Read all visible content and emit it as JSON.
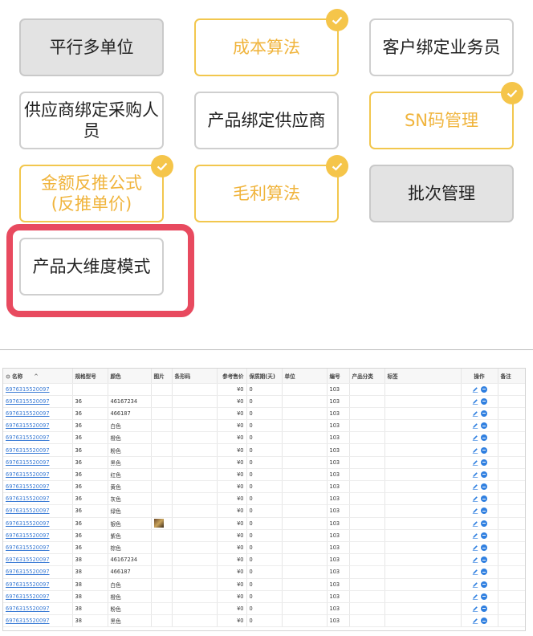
{
  "options": [
    {
      "label": "平行多单位",
      "state": "disabled"
    },
    {
      "label": "成本算法",
      "state": "selected"
    },
    {
      "label": "客户绑定业务员",
      "state": "normal"
    },
    {
      "label": "供应商绑定采购人员",
      "state": "normal"
    },
    {
      "label": "产品绑定供应商",
      "state": "normal"
    },
    {
      "label": "SN码管理",
      "state": "selected"
    },
    {
      "label": "金额反推公式(反推单价)",
      "state": "selected"
    },
    {
      "label": "毛利算法",
      "state": "selected"
    },
    {
      "label": "批次管理",
      "state": "disabled"
    },
    {
      "label": "产品大维度模式",
      "state": "highlighted"
    }
  ],
  "colors": {
    "selected": "#f0b43c",
    "highlight": "#e84a5f",
    "link": "#3a7bd5"
  },
  "table": {
    "headers": {
      "name": "名称",
      "spec": "规格型号",
      "color": "颜色",
      "image": "图片",
      "barcode": "条形码",
      "price": "参考售价",
      "shelf": "保质期(天)",
      "unit": "单位",
      "code": "编号",
      "category": "产品分类",
      "tag": "标签",
      "ops": "操作",
      "remark": "备注"
    },
    "rows": [
      {
        "name": "6976315520097",
        "spec": "",
        "color": "",
        "price": "¥0",
        "shelf": "0",
        "code": "103",
        "image": false
      },
      {
        "name": "6976315520097",
        "spec": "36",
        "color": "46167234",
        "price": "¥0",
        "shelf": "0",
        "code": "103",
        "image": false
      },
      {
        "name": "6976315520097",
        "spec": "36",
        "color": "466187",
        "price": "¥0",
        "shelf": "0",
        "code": "103",
        "image": false
      },
      {
        "name": "6976315520097",
        "spec": "36",
        "color": "白色",
        "price": "¥0",
        "shelf": "0",
        "code": "103",
        "image": false
      },
      {
        "name": "6976315520097",
        "spec": "36",
        "color": "橙色",
        "price": "¥0",
        "shelf": "0",
        "code": "103",
        "image": false
      },
      {
        "name": "6976315520097",
        "spec": "36",
        "color": "粉色",
        "price": "¥0",
        "shelf": "0",
        "code": "103",
        "image": false
      },
      {
        "name": "6976315520097",
        "spec": "36",
        "color": "黑色",
        "price": "¥0",
        "shelf": "0",
        "code": "103",
        "image": false
      },
      {
        "name": "6976315520097",
        "spec": "36",
        "color": "红色",
        "price": "¥0",
        "shelf": "0",
        "code": "103",
        "image": false
      },
      {
        "name": "6976315520097",
        "spec": "36",
        "color": "黄色",
        "price": "¥0",
        "shelf": "0",
        "code": "103",
        "image": false
      },
      {
        "name": "6976315520097",
        "spec": "36",
        "color": "灰色",
        "price": "¥0",
        "shelf": "0",
        "code": "103",
        "image": false
      },
      {
        "name": "6976315520097",
        "spec": "36",
        "color": "绿色",
        "price": "¥0",
        "shelf": "0",
        "code": "103",
        "image": false
      },
      {
        "name": "6976315520097",
        "spec": "36",
        "color": "银色",
        "price": "¥0",
        "shelf": "0",
        "code": "103",
        "image": true
      },
      {
        "name": "6976315520097",
        "spec": "36",
        "color": "紫色",
        "price": "¥0",
        "shelf": "0",
        "code": "103",
        "image": false
      },
      {
        "name": "6976315520097",
        "spec": "36",
        "color": "棕色",
        "price": "¥0",
        "shelf": "0",
        "code": "103",
        "image": false
      },
      {
        "name": "6976315520097",
        "spec": "38",
        "color": "46167234",
        "price": "¥0",
        "shelf": "0",
        "code": "103",
        "image": false
      },
      {
        "name": "6976315520097",
        "spec": "38",
        "color": "466187",
        "price": "¥0",
        "shelf": "0",
        "code": "103",
        "image": false
      },
      {
        "name": "6976315520097",
        "spec": "38",
        "color": "白色",
        "price": "¥0",
        "shelf": "0",
        "code": "103",
        "image": false
      },
      {
        "name": "6976315520097",
        "spec": "38",
        "color": "橙色",
        "price": "¥0",
        "shelf": "0",
        "code": "103",
        "image": false
      },
      {
        "name": "6976315520097",
        "spec": "38",
        "color": "粉色",
        "price": "¥0",
        "shelf": "0",
        "code": "103",
        "image": false
      },
      {
        "name": "6976315520097",
        "spec": "38",
        "color": "黑色",
        "price": "¥0",
        "shelf": "0",
        "code": "103",
        "image": false
      }
    ]
  }
}
